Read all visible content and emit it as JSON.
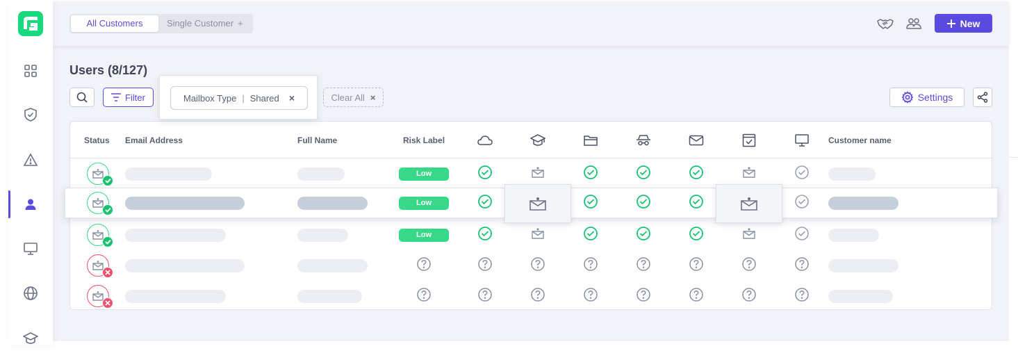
{
  "header": {
    "tabs": [
      {
        "label": "All Customers",
        "active": true
      },
      {
        "label": "Single Customer",
        "active": false,
        "suffix": "+"
      }
    ],
    "new_button_label": "New"
  },
  "toolbar": {
    "page_title": "Users (8/127)",
    "filter_label": "Filter",
    "filter_chip": {
      "field": "Mailbox Type",
      "separator": "|",
      "value": "Shared",
      "remove": "×"
    },
    "clear_all_label": "Clear All",
    "clear_all_remove": "×",
    "settings_label": "Settings"
  },
  "table": {
    "columns": {
      "status": "Status",
      "email": "Email Address",
      "full_name": "Full Name",
      "risk_label": "Risk Label",
      "customer_name": "Customer name"
    },
    "icon_columns": [
      "cloud-icon",
      "graduation-cap-icon",
      "folder-icon",
      "incognito-icon",
      "mail-icon",
      "browser-check-icon",
      "monitor-icon"
    ],
    "rows": [
      {
        "status": "ok",
        "risk": "Low",
        "cells": [
          "check",
          "mailbox",
          "check",
          "check",
          "check",
          "mailbox",
          "check-gray"
        ]
      },
      {
        "status": "ok",
        "risk": "Low",
        "cells": [
          "check",
          "mailbox",
          "check",
          "check",
          "check",
          "mailbox",
          "check-gray"
        ],
        "highlighted": true
      },
      {
        "status": "ok",
        "risk": "Low",
        "cells": [
          "check",
          "mailbox",
          "check",
          "check",
          "check",
          "mailbox",
          "check-gray"
        ]
      },
      {
        "status": "bad",
        "risk": null,
        "cells": [
          "question",
          "question",
          "question",
          "question",
          "question",
          "question",
          "question"
        ]
      },
      {
        "status": "bad",
        "risk": null,
        "cells": [
          "question",
          "question",
          "question",
          "question",
          "question",
          "question",
          "question"
        ]
      }
    ]
  },
  "colors": {
    "accent": "#5b4ae0",
    "success": "#19c26f",
    "low_badge": "#37d888",
    "error": "#f0506e",
    "logo": "#19d97f"
  }
}
